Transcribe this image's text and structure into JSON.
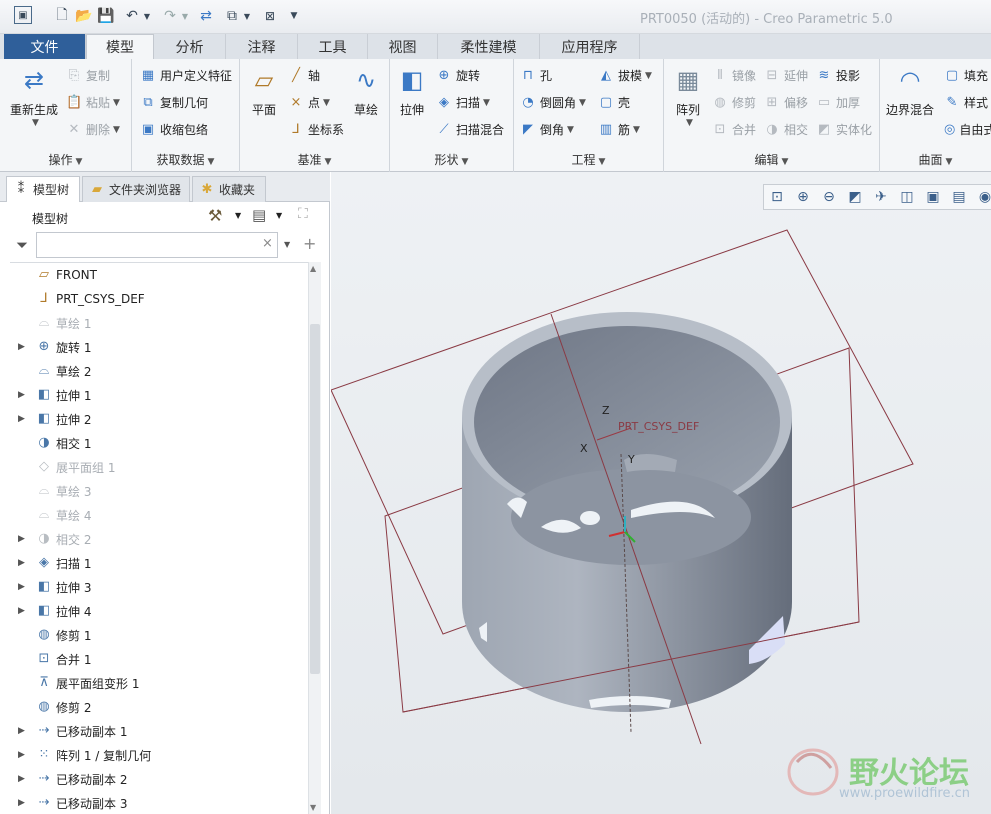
{
  "app": {
    "title": "PRT0050 (活动的) - Creo Parametric 5.0"
  },
  "tabs": [
    {
      "label": "文件"
    },
    {
      "label": "模型"
    },
    {
      "label": "分析"
    },
    {
      "label": "注释"
    },
    {
      "label": "工具"
    },
    {
      "label": "视图"
    },
    {
      "label": "柔性建模"
    },
    {
      "label": "应用程序"
    }
  ],
  "ribbon": {
    "operations": {
      "label": "操作",
      "regenerate": "重新生成",
      "copy": "复制",
      "paste": "粘贴",
      "delete": "删除"
    },
    "get_data": {
      "label": "获取数据",
      "udf": "用户定义特征",
      "copy_geom": "复制几何",
      "shrinkwrap": "收缩包络"
    },
    "datum": {
      "label": "基准",
      "plane": "平面",
      "axis": "轴",
      "point": "点",
      "csys": "坐标系",
      "sketch": "草绘"
    },
    "shapes": {
      "label": "形状",
      "extrude": "拉伸",
      "revolve": "旋转",
      "sweep": "扫描",
      "swept_blend": "扫描混合"
    },
    "engineering": {
      "label": "工程",
      "hole": "孔",
      "round": "倒圆角",
      "chamfer": "倒角",
      "draft": "拔模",
      "shell": "壳",
      "rib": "筋"
    },
    "editing": {
      "label": "编辑",
      "pattern": "阵列",
      "mirror": "镜像",
      "extend": "延伸",
      "project": "投影",
      "trim": "修剪",
      "offset": "偏移",
      "thicken": "加厚",
      "merge": "合并",
      "intersect": "相交",
      "solidify": "实体化"
    },
    "surfaces": {
      "label": "曲面",
      "boundary_blend": "边界混合",
      "fill": "填充",
      "style": "样式",
      "freestyle": "自由式"
    }
  },
  "panel": {
    "tabs": [
      {
        "label": "模型树"
      },
      {
        "label": "文件夹浏览器"
      },
      {
        "label": "收藏夹"
      }
    ],
    "tree_title": "模型树",
    "filter_placeholder": ""
  },
  "tree": {
    "items": [
      {
        "label": "FRONT"
      },
      {
        "label": "PRT_CSYS_DEF"
      },
      {
        "label": "草绘 1"
      },
      {
        "label": "旋转 1"
      },
      {
        "label": "草绘 2"
      },
      {
        "label": "拉伸 1"
      },
      {
        "label": "拉伸 2"
      },
      {
        "label": "相交 1"
      },
      {
        "label": "展平面组 1"
      },
      {
        "label": "草绘 3"
      },
      {
        "label": "草绘 4"
      },
      {
        "label": "相交 2"
      },
      {
        "label": "扫描 1"
      },
      {
        "label": "拉伸 3"
      },
      {
        "label": "拉伸 4"
      },
      {
        "label": "修剪 1"
      },
      {
        "label": "合并 1"
      },
      {
        "label": "展平面组变形 1"
      },
      {
        "label": "修剪 2"
      },
      {
        "label": "已移动副本 1"
      },
      {
        "label": "阵列 1 / 复制几何"
      },
      {
        "label": "已移动副本 2"
      },
      {
        "label": "已移动副本 3"
      }
    ]
  },
  "viewport": {
    "axis_z": "Z",
    "axis_x": "X",
    "axis_y": "Y",
    "csys_label": "PRT_CSYS_DEF",
    "watermark_cn": "野火论坛",
    "watermark_url": "www.proewildfire.cn"
  }
}
